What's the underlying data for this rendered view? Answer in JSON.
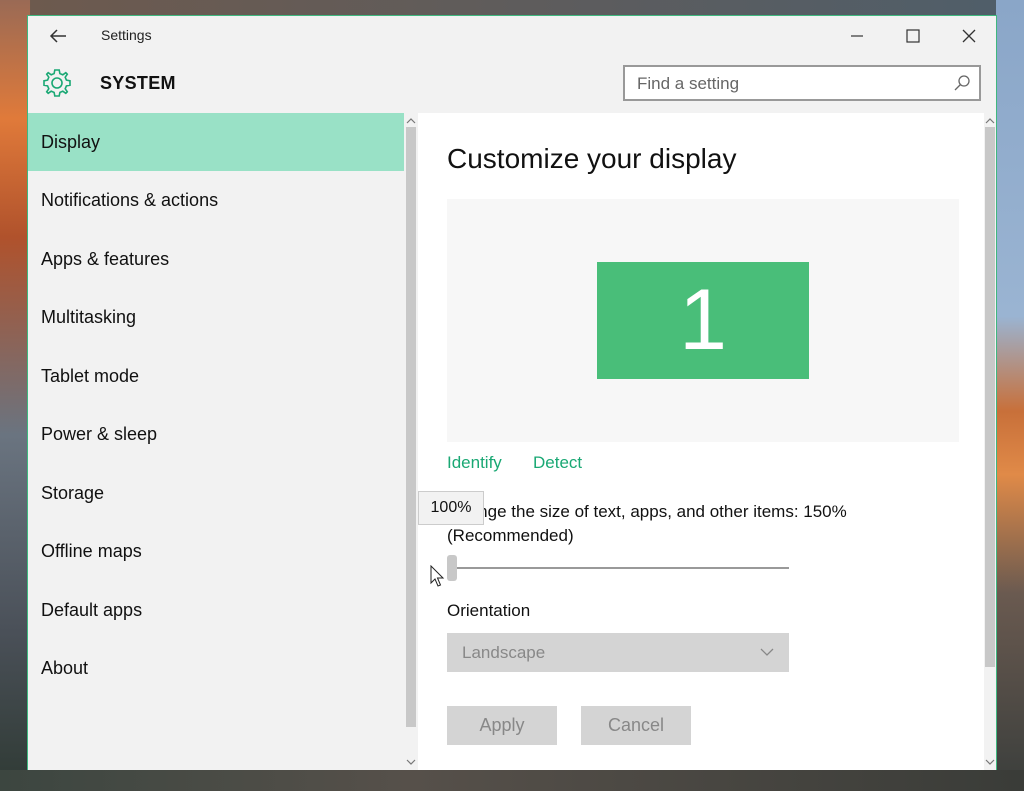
{
  "window": {
    "title": "Settings"
  },
  "header": {
    "section": "SYSTEM",
    "search_placeholder": "Find a setting"
  },
  "sidebar": {
    "items": [
      {
        "label": "Display",
        "active": true
      },
      {
        "label": "Notifications & actions"
      },
      {
        "label": "Apps & features"
      },
      {
        "label": "Multitasking"
      },
      {
        "label": "Tablet mode"
      },
      {
        "label": "Power & sleep"
      },
      {
        "label": "Storage"
      },
      {
        "label": "Offline maps"
      },
      {
        "label": "Default apps"
      },
      {
        "label": "About"
      }
    ]
  },
  "main": {
    "title": "Customize your display",
    "monitor_number": "1",
    "identify_label": "Identify",
    "detect_label": "Detect",
    "size_label": "Change the size of text, apps, and other items: 150% (Recommended)",
    "slider_tooltip": "100%",
    "orientation_label": "Orientation",
    "orientation_value": "Landscape",
    "apply_label": "Apply",
    "cancel_label": "Cancel"
  },
  "colors": {
    "accent": "#1aa874",
    "active_nav": "#99e1c6",
    "monitor": "#49be79"
  }
}
